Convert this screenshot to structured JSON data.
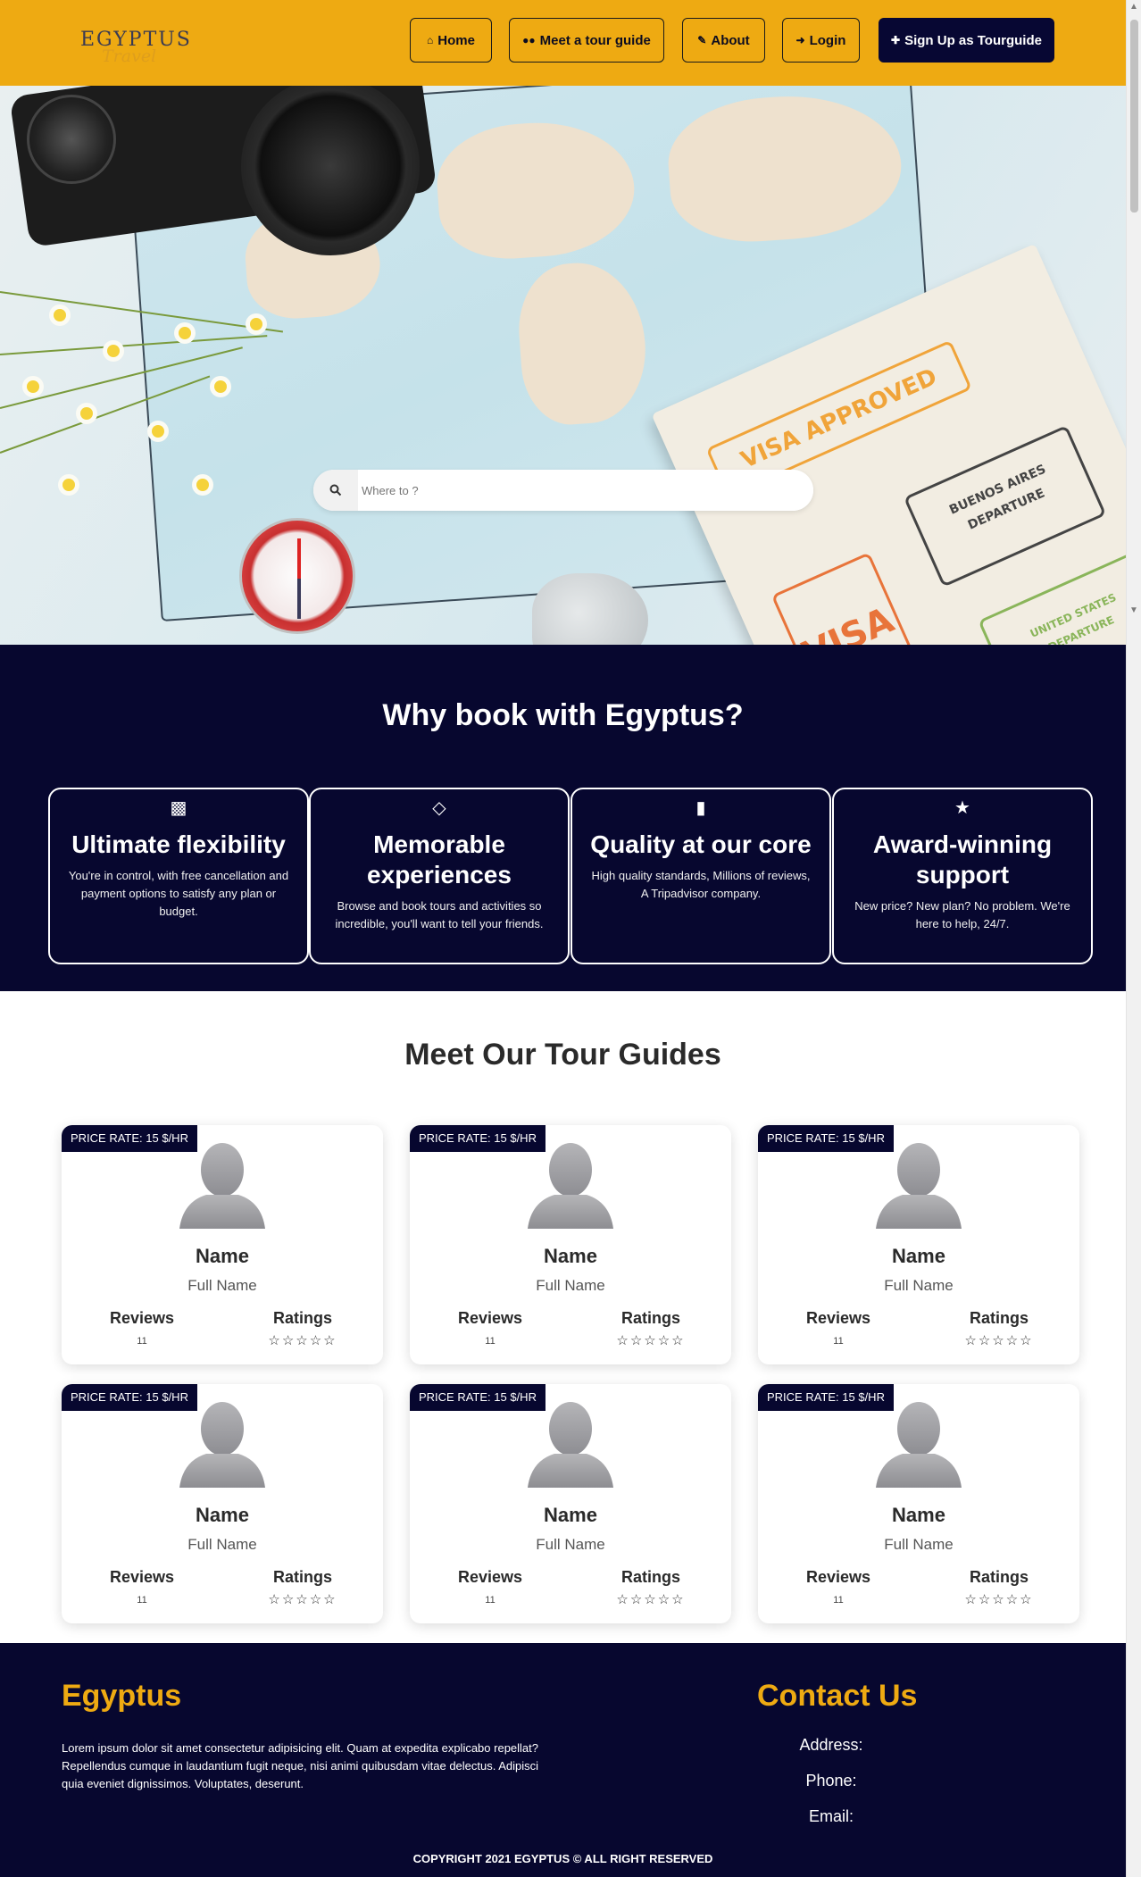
{
  "header": {
    "logo_text": "EGYPTUS",
    "logo_sub": "Travel",
    "nav": [
      {
        "label": "Home",
        "icon": "home-icon"
      },
      {
        "label": "Meet a tour guide",
        "icon": "users-icon"
      },
      {
        "label": "About",
        "icon": "edit-icon"
      },
      {
        "label": "Login",
        "icon": "sign-in-icon"
      },
      {
        "label": "Sign Up as Tourguide",
        "icon": "user-plus-icon"
      }
    ],
    "accent_color": "#eeaa12",
    "navy_color": "#07072f"
  },
  "hero": {
    "search_placeholder": "Where to ?",
    "search_icon": "search-icon"
  },
  "why": {
    "title": "Why book with Egyptus?",
    "features": [
      {
        "icon": "money-icon",
        "title": "Ultimate flexibility",
        "text": "You're in control, with free cancellation and payment options to satisfy any plan or budget."
      },
      {
        "icon": "diamond-icon",
        "title": "Memorable experiences",
        "text": "Browse and book tours and activities so incredible, you'll want to tell your friends."
      },
      {
        "icon": "book-icon",
        "title": "Quality at our core",
        "text": "High quality standards, Millions of reviews, A Tripadvisor company."
      },
      {
        "icon": "trophy-icon",
        "title": "Award-winning support",
        "text": "New price? New plan? No problem. We're here to help, 24/7."
      }
    ]
  },
  "guides": {
    "title": "Meet Our Tour Guides",
    "cards": [
      {
        "price": "PRICE RATE: 15 $/HR",
        "name": "Name",
        "full_name": "Full Name",
        "reviews_label": "Reviews",
        "reviews": "11",
        "ratings_label": "Ratings",
        "stars": "☆☆☆☆☆"
      },
      {
        "price": "PRICE RATE: 15 $/HR",
        "name": "Name",
        "full_name": "Full Name",
        "reviews_label": "Reviews",
        "reviews": "11",
        "ratings_label": "Ratings",
        "stars": "☆☆☆☆☆"
      },
      {
        "price": "PRICE RATE: 15 $/HR",
        "name": "Name",
        "full_name": "Full Name",
        "reviews_label": "Reviews",
        "reviews": "11",
        "ratings_label": "Ratings",
        "stars": "☆☆☆☆☆"
      },
      {
        "price": "PRICE RATE: 15 $/HR",
        "name": "Name",
        "full_name": "Full Name",
        "reviews_label": "Reviews",
        "reviews": "11",
        "ratings_label": "Ratings",
        "stars": "☆☆☆☆☆"
      },
      {
        "price": "PRICE RATE: 15 $/HR",
        "name": "Name",
        "full_name": "Full Name",
        "reviews_label": "Reviews",
        "reviews": "11",
        "ratings_label": "Ratings",
        "stars": "☆☆☆☆☆"
      },
      {
        "price": "PRICE RATE: 15 $/HR",
        "name": "Name",
        "full_name": "Full Name",
        "reviews_label": "Reviews",
        "reviews": "11",
        "ratings_label": "Ratings",
        "stars": "☆☆☆☆☆"
      }
    ]
  },
  "footer": {
    "brand": "Egyptus",
    "description": "Lorem ipsum dolor sit amet consectetur adipisicing elit. Quam at expedita explicabo repellat? Repellendus cumque in laudantium fugit neque, nisi animi quibusdam vitae delectus. Adipisci quia eveniet dignissimos. Voluptates, deserunt.",
    "contact_title": "Contact Us",
    "address_label": "Address:",
    "phone_label": "Phone:",
    "email_label": "Email:",
    "copyright": "COPYRIGHT 2021 EGYPTUS © ALL RIGHT RESERVED"
  }
}
